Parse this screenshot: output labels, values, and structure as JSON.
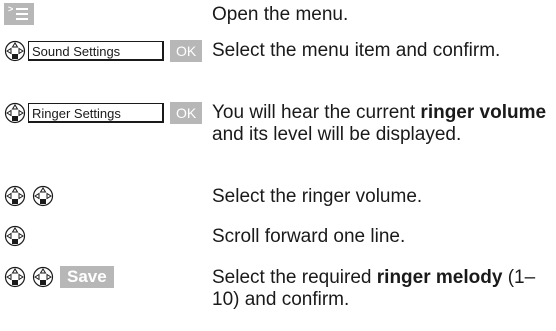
{
  "steps": [
    {
      "desc": "Open the menu."
    },
    {
      "display": "Sound Settings",
      "key": "OK",
      "desc": "Select the menu item and confirm."
    },
    {
      "display": "Ringer Settings",
      "key": "OK",
      "desc_pre": "You will hear the current ",
      "desc_bold": "ringer volume",
      "desc_post": " and its level will be displayed."
    },
    {
      "desc": "Select the ringer volume."
    },
    {
      "desc": "Scroll forward one line."
    },
    {
      "key": "Save",
      "desc_pre": "Select the required ",
      "desc_bold": "ringer melody",
      "desc_post": " (1–10) and confirm."
    }
  ],
  "icons": {
    "menu_key": "menu-key-icon",
    "control_key": "control-key-icon"
  },
  "colors": {
    "key_background": "#b7b7b7",
    "text": "#1a1a1a"
  }
}
